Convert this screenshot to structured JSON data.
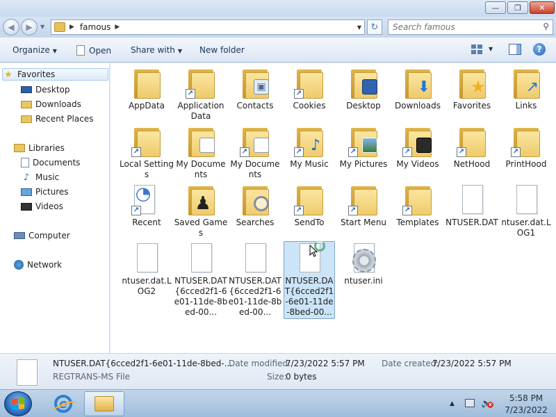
{
  "window": {
    "minimize_glyph": "—",
    "maximize_glyph": "❐",
    "close_glyph": "✕"
  },
  "nav": {
    "back_glyph": "◀",
    "forward_glyph": "▶",
    "breadcrumb": "famous",
    "refresh_glyph": "↻",
    "search_placeholder": "Search famous"
  },
  "toolbar": {
    "organize": "Organize",
    "open": "Open",
    "share_with": "Share with",
    "new_folder": "New folder",
    "help_glyph": "?"
  },
  "sidebar": {
    "favorites": "Favorites",
    "desktop": "Desktop",
    "downloads": "Downloads",
    "recent_places": "Recent Places",
    "libraries": "Libraries",
    "documents": "Documents",
    "music": "Music",
    "pictures": "Pictures",
    "videos": "Videos",
    "computer": "Computer",
    "network": "Network"
  },
  "files": [
    {
      "label": "AppData",
      "kind": "folder",
      "shortcut": false
    },
    {
      "label": "Application Data",
      "kind": "folder",
      "shortcut": true
    },
    {
      "label": "Contacts",
      "kind": "folder",
      "shortcut": false,
      "overlay": "contacts-icon"
    },
    {
      "label": "Cookies",
      "kind": "folder",
      "shortcut": true
    },
    {
      "label": "Desktop",
      "kind": "folder",
      "shortcut": false,
      "overlay": "desktop-icon"
    },
    {
      "label": "Downloads",
      "kind": "folder",
      "shortcut": false,
      "overlay": "download-arrow-icon"
    },
    {
      "label": "Favorites",
      "kind": "folder",
      "shortcut": false,
      "overlay": "star-icon"
    },
    {
      "label": "Links",
      "kind": "folder",
      "shortcut": false,
      "overlay": "link-arrow-icon"
    },
    {
      "label": "Local Settings",
      "kind": "folder",
      "shortcut": true
    },
    {
      "label": "My Documents",
      "kind": "folder",
      "shortcut": false,
      "overlay": "document-icon"
    },
    {
      "label": "My Documents",
      "kind": "folder",
      "shortcut": true
    },
    {
      "label": "My Music",
      "kind": "folder",
      "shortcut": true,
      "overlay": "music-note-icon"
    },
    {
      "label": "My Pictures",
      "kind": "folder",
      "shortcut": true,
      "overlay": "picture-icon"
    },
    {
      "label": "My Videos",
      "kind": "folder",
      "shortcut": true,
      "overlay": "film-icon"
    },
    {
      "label": "NetHood",
      "kind": "folder",
      "shortcut": true
    },
    {
      "label": "PrintHood",
      "kind": "folder",
      "shortcut": true
    },
    {
      "label": "Recent",
      "kind": "recent",
      "shortcut": true
    },
    {
      "label": "Saved Games",
      "kind": "folder",
      "shortcut": false,
      "overlay": "chess-piece-icon"
    },
    {
      "label": "Searches",
      "kind": "folder",
      "shortcut": false,
      "overlay": "magnifier-icon"
    },
    {
      "label": "SendTo",
      "kind": "folder",
      "shortcut": true
    },
    {
      "label": "Start Menu",
      "kind": "folder",
      "shortcut": true
    },
    {
      "label": "Templates",
      "kind": "folder",
      "shortcut": true
    },
    {
      "label": "NTUSER.DAT",
      "kind": "file",
      "shortcut": false
    },
    {
      "label": "ntuser.dat.LOG1",
      "kind": "file",
      "shortcut": false
    },
    {
      "label": "ntuser.dat.LOG2",
      "kind": "file",
      "shortcut": false
    },
    {
      "label": "NTUSER.DAT{6cced2f1-6e01-11de-8bed-00...",
      "kind": "file",
      "shortcut": false
    },
    {
      "label": "NTUSER.DAT{6cced2f1-6e01-11de-8bed-00...",
      "kind": "file",
      "shortcut": false
    },
    {
      "label": "NTUSER.DAT{6cced2f1-6e01-11de-8bed-00...",
      "kind": "file",
      "shortcut": false,
      "selected": true
    },
    {
      "label": "ntuser.ini",
      "kind": "settings",
      "shortcut": false
    }
  ],
  "details": {
    "name": "NTUSER.DAT{6cced2f1-6e01-11de-8bed-...",
    "type": "REGTRANS-MS File",
    "modified_label": "Date modified:",
    "modified_value": "7/23/2022 5:57 PM",
    "created_label": "Date created:",
    "created_value": "7/23/2022 5:57 PM",
    "size_label": "Size:",
    "size_value": "0 bytes"
  },
  "taskbar": {
    "tray_arrow": "▲",
    "time": "5:58 PM",
    "date": "7/23/2022"
  }
}
